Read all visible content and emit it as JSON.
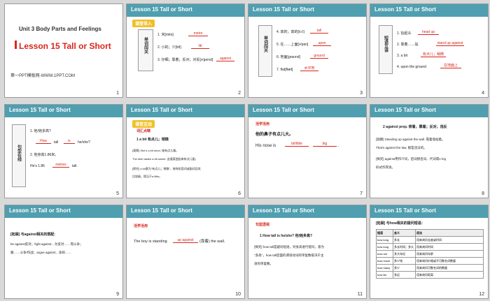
{
  "slides": [
    {
      "number": "1",
      "unit": "Unit 3  Body Parts and Feelings",
      "title": "Lesson 15  Tall or Short",
      "footer": "第一PPT模板网-WWW.1PPT.COM"
    },
    {
      "number": "2",
      "header": "Lesson 15    Tall or Short",
      "tag": "课堂导入",
      "side": "单词闯关",
      "items": [
        "1.  米[mitə]",
        "2.  小的；少[lɪtl]",
        "3.  仔细；靠着；反对；对反[ə'genst]"
      ],
      "answers": [
        "metre",
        "litt",
        "against"
      ]
    },
    {
      "number": "3",
      "header": "Lesson 15    Tall or Short",
      "side": "单词闯关",
      "items": [
        "4.  高的；高的[tɔːl]",
        "5.  在……上面[ə'pɒn]",
        "6.  地面[graʊnd]",
        "7.  flat[flæt]"
      ],
      "answers": [
        "tall",
        "upon",
        "ground",
        "水平地"
      ]
    },
    {
      "number": "4",
      "header": "Lesson 15    Tall or Short",
      "side": "短语互译",
      "items": [
        "1.  抬起头",
        "2.  靠着……站",
        "3.  a bit",
        "4.  upon the ground"
      ],
      "answers": [
        "head up",
        "stand up against",
        "有点儿；稍微",
        "在地面上"
      ]
    },
    {
      "number": "5",
      "header": "Lesson 15    Tall or Short",
      "side": "句型在线",
      "items": [
        "1.  他/她多高?",
        "tall",
        "he/she?",
        "2.  他身高1.86米。",
        "He's 1.86",
        "tall."
      ],
      "answers": [
        "How",
        "is",
        "metres"
      ]
    },
    {
      "number": "6",
      "header": "Lesson 15    Tall or Short",
      "tag": "课堂互动",
      "sub": "词汇点睛",
      "lines": [
        "1      a bit  有点儿；稍微",
        "[观察] She's a bit short.  她有点儿矮。",
        "The dish tastes a bit sweet.  这道菜尝起来有点儿甜。",
        "[探究] a bit意为\"有点儿；稍微\"，修饰形容词或副词及其",
        "比较级，相当于a little。"
      ]
    },
    {
      "number": "7",
      "header": "Lesson 15    Tall or Short",
      "sub": "活学活用",
      "lines": [
        "他的鼻子有点儿大。",
        "His nose is",
        "."
      ],
      "answers": [
        "bit/little",
        "big"
      ]
    },
    {
      "number": "8",
      "header": "Lesson 15    Tall or Short",
      "lines": [
        "2    against prep. 倚着，靠着；反对，违反",
        "[观察] Standing up against the wall. 靠着墙站着。",
        "That's against the law. 那是违法的。",
        "[探究] against用作介词，后词接名词、代词或v-ing",
        "形式作宾语。"
      ]
    },
    {
      "number": "9",
      "header": "Lesson 15    Tall or Short",
      "lines": [
        "[拓展] 与against相关的搭配:",
        "be against反对；fight against…为反对……而斗争；",
        "跟……斗争/作战；argue against…争辩……"
      ]
    },
    {
      "number": "10",
      "header": "Lesson 15    Tall or Short",
      "sub": "活学活用",
      "lines": [
        "The boy is standing",
        "(靠着) the wall."
      ],
      "answers": [
        "up against"
      ]
    },
    {
      "number": "11",
      "header": "Lesson 15    Tall or Short",
      "sub": "句型透视",
      "lines": [
        "1    How tall is he/she? 他/她多高?",
        "[探究]  how tall是疑问短语，对身高进行提问，意为",
        "\"多高\"，how tall后面的谓语动词的单复数取决于主",
        "语的单复数。"
      ]
    },
    {
      "number": "12",
      "header": "Lesson 15    Tall or Short",
      "lines": [
        "[拓展] 与how相关的疑问短语："
      ],
      "table": {
        "headers": [
          "短语",
          "含义",
          "用法"
        ],
        "rows": [
          [
            "how long",
            "多长",
            "用来询问长度或时间"
          ],
          [
            "how long",
            "多长时间；多久",
            "用来询问时间"
          ],
          [
            "how old",
            "多大年纪",
            "用来询问年龄"
          ],
          [
            "how much",
            "多少钱",
            "用来询问价格或不可数名词数量"
          ],
          [
            "how many",
            "多少",
            "用来询问可数名词的数量"
          ],
          [
            "how far",
            "多远",
            "用来询问距离"
          ]
        ]
      }
    }
  ]
}
